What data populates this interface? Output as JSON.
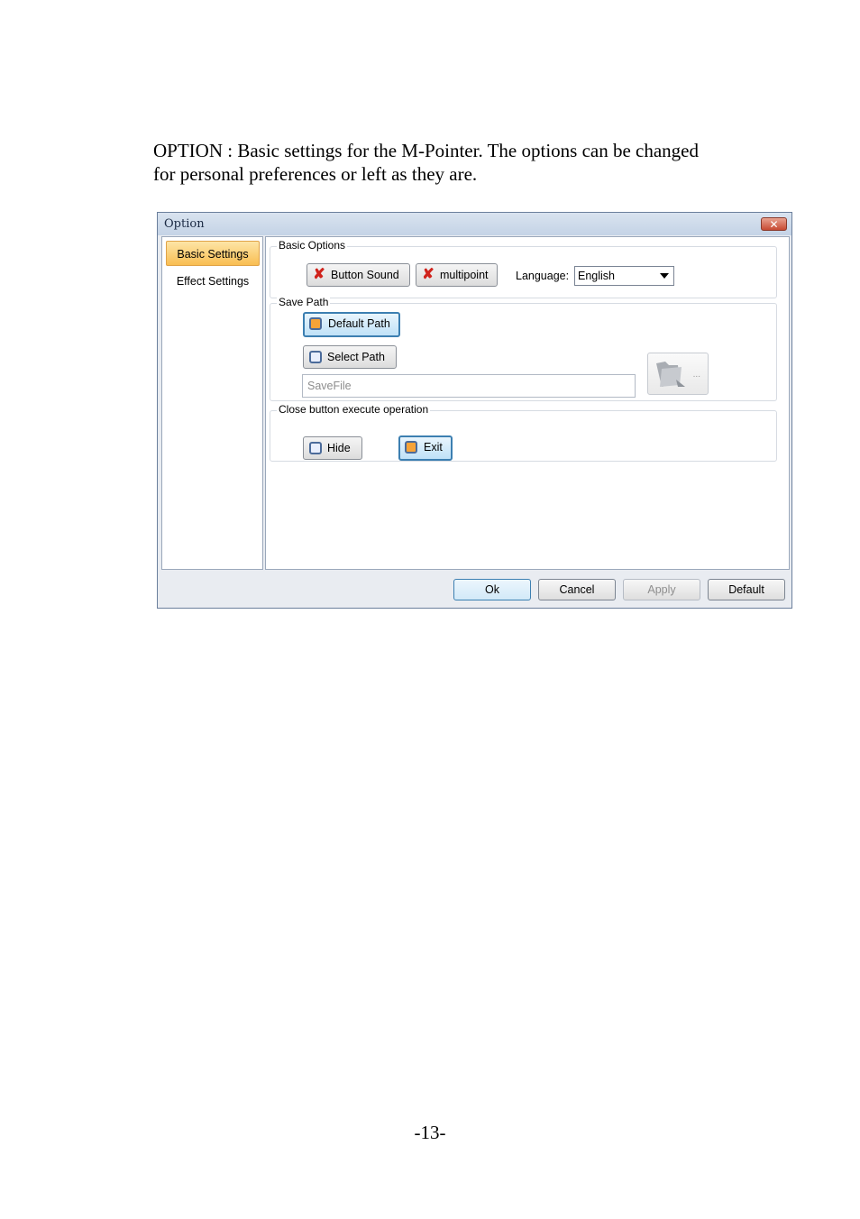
{
  "intro": {
    "line1": "OPTION : Basic settings for the M-Pointer. The options can be changed",
    "line2": "for personal preferences or left as they are."
  },
  "dialog": {
    "title": "Option",
    "close_glyph": "✕",
    "nav": {
      "items": [
        {
          "label": "Basic Settings",
          "active": true
        },
        {
          "label": "Effect Settings",
          "active": false
        }
      ]
    },
    "basic_options": {
      "label": "Basic Options",
      "button_sound": "Button Sound",
      "multipoint": "multipoint",
      "language_label": "Language:",
      "language_value": "English"
    },
    "save_path": {
      "label": "Save Path",
      "default_path": "Default Path",
      "select_path": "Select Path",
      "save_file_placeholder": "SaveFile",
      "folder_dots": "..."
    },
    "close_operation": {
      "label": "Close button execute operation",
      "hide": "Hide",
      "exit": "Exit"
    },
    "footer": {
      "ok": "Ok",
      "cancel": "Cancel",
      "apply": "Apply",
      "default": "Default"
    }
  },
  "page_number": "-13-"
}
